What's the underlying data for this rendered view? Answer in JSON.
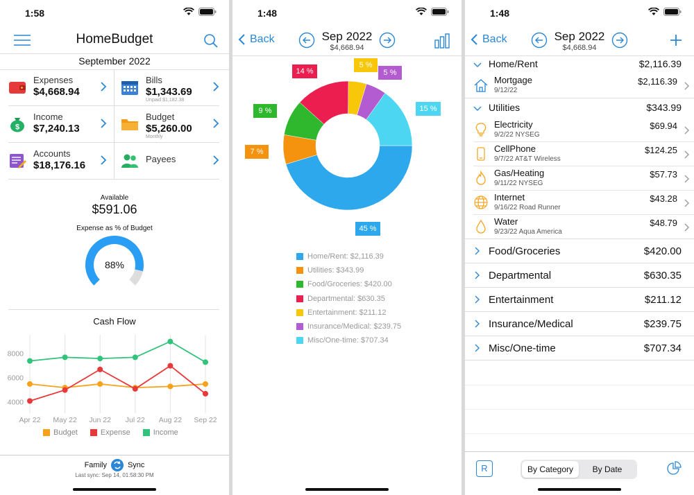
{
  "colors": {
    "accent": "#2a87d6",
    "home_rent": "#2ea8ec",
    "utilities": "#f5930f",
    "food": "#2fb82e",
    "departmental": "#ec1d4f",
    "entertainment": "#f8c70a",
    "insurance": "#b35bd0",
    "misc": "#4dd6f2",
    "budget_line": "#f7a21a",
    "expense_line": "#e8393a",
    "income_line": "#31c27b"
  },
  "phone1": {
    "time": "1:58",
    "title": "HomeBudget",
    "month": "September 2022",
    "tiles": {
      "expenses": {
        "label": "Expenses",
        "value": "$4,668.94",
        "icon": "wallet-icon"
      },
      "bills": {
        "label": "Bills",
        "value": "$1,343.69",
        "sub": "Unpaid $1,182.38",
        "icon": "calendar-icon"
      },
      "income": {
        "label": "Income",
        "value": "$7,240.13",
        "icon": "money-bag-icon"
      },
      "budget": {
        "label": "Budget",
        "value": "$5,260.00",
        "sub": "Monthly",
        "icon": "folder-icon"
      },
      "accounts": {
        "label": "Accounts",
        "value": "$18,176.16",
        "icon": "ledger-icon"
      },
      "payees": {
        "label": "Payees",
        "icon": "people-icon"
      }
    },
    "available_label": "Available",
    "available_value": "$591.06",
    "gauge_label": "Expense as % of Budget",
    "gauge_value": "88%",
    "gauge_fraction": 0.88,
    "cashflow_title": "Cash Flow",
    "footer_family": "Family",
    "footer_sync": "Sync",
    "footer_last_sync": "Last sync: Sep 14, 01:58:30 PM"
  },
  "chart_data": {
    "type": "line",
    "title": "Cash Flow",
    "categories": [
      "Apr 22",
      "May 22",
      "Jun 22",
      "Jul 22",
      "Aug 22",
      "Sep 22"
    ],
    "y_ticks": [
      "8000",
      "6000",
      "4000"
    ],
    "ylim": [
      3500,
      9500
    ],
    "series": [
      {
        "name": "Budget",
        "values": [
          5450,
          5150,
          5450,
          5150,
          5250,
          5450
        ]
      },
      {
        "name": "Expense",
        "values": [
          4050,
          4950,
          6650,
          5050,
          6950,
          4650
        ]
      },
      {
        "name": "Income",
        "values": [
          7350,
          7650,
          7550,
          7650,
          8950,
          7250
        ]
      }
    ],
    "legend_position": "bottom"
  },
  "phone2": {
    "time": "1:48",
    "back": "Back",
    "title": "Sep 2022",
    "subtitle": "$4,668.94",
    "donut_segments": [
      {
        "key": "home_rent",
        "label": "Home/Rent: $2,116.39",
        "value": 2116.39,
        "pct": "45 %"
      },
      {
        "key": "utilities",
        "label": "Utilities: $343.99",
        "value": 343.99,
        "pct": "7 %"
      },
      {
        "key": "food",
        "label": "Food/Groceries: $420.00",
        "value": 420.0,
        "pct": "9 %"
      },
      {
        "key": "departmental",
        "label": "Departmental: $630.35",
        "value": 630.35,
        "pct": "14 %"
      },
      {
        "key": "entertainment",
        "label": "Entertainment: $211.12",
        "value": 211.12,
        "pct": "5 %"
      },
      {
        "key": "insurance",
        "label": "Insurance/Medical: $239.75",
        "value": 239.75,
        "pct": "5 %"
      },
      {
        "key": "misc",
        "label": "Misc/One-time: $707.34",
        "value": 707.34,
        "pct": "15 %"
      }
    ]
  },
  "phone3": {
    "time": "1:48",
    "back": "Back",
    "title": "Sep 2022",
    "subtitle": "$4,668.94",
    "home_rent": {
      "name": "Home/Rent",
      "amount": "$2,116.39"
    },
    "mortgage": {
      "name": "Mortgage",
      "sub": "9/12/22",
      "amount": "$2,116.39",
      "icon": "house-icon"
    },
    "utilities": {
      "name": "Utilities",
      "amount": "$343.99"
    },
    "utility_items": [
      {
        "name": "Electricity",
        "sub": "9/2/22 NYSEG",
        "amount": "$69.94",
        "icon": "lightbulb-icon"
      },
      {
        "name": "CellPhone",
        "sub": "9/7/22 AT&T Wireless",
        "amount": "$124.25",
        "icon": "phone-icon"
      },
      {
        "name": "Gas/Heating",
        "sub": "9/11/22 NYSEG",
        "amount": "$57.73",
        "icon": "flame-icon"
      },
      {
        "name": "Internet",
        "sub": "9/16/22 Road Runner",
        "amount": "$43.28",
        "icon": "globe-icon"
      },
      {
        "name": "Water",
        "sub": "9/23/22 Aqua America",
        "amount": "$48.79",
        "icon": "droplet-icon"
      }
    ],
    "collapsed_categories": [
      {
        "name": "Food/Groceries",
        "amount": "$420.00"
      },
      {
        "name": "Departmental",
        "amount": "$630.35"
      },
      {
        "name": "Entertainment",
        "amount": "$211.12"
      },
      {
        "name": "Insurance/Medical",
        "amount": "$239.75"
      },
      {
        "name": "Misc/One-time",
        "amount": "$707.34"
      }
    ],
    "r_button": "R",
    "seg_by_category": "By Category",
    "seg_by_date": "By Date"
  }
}
